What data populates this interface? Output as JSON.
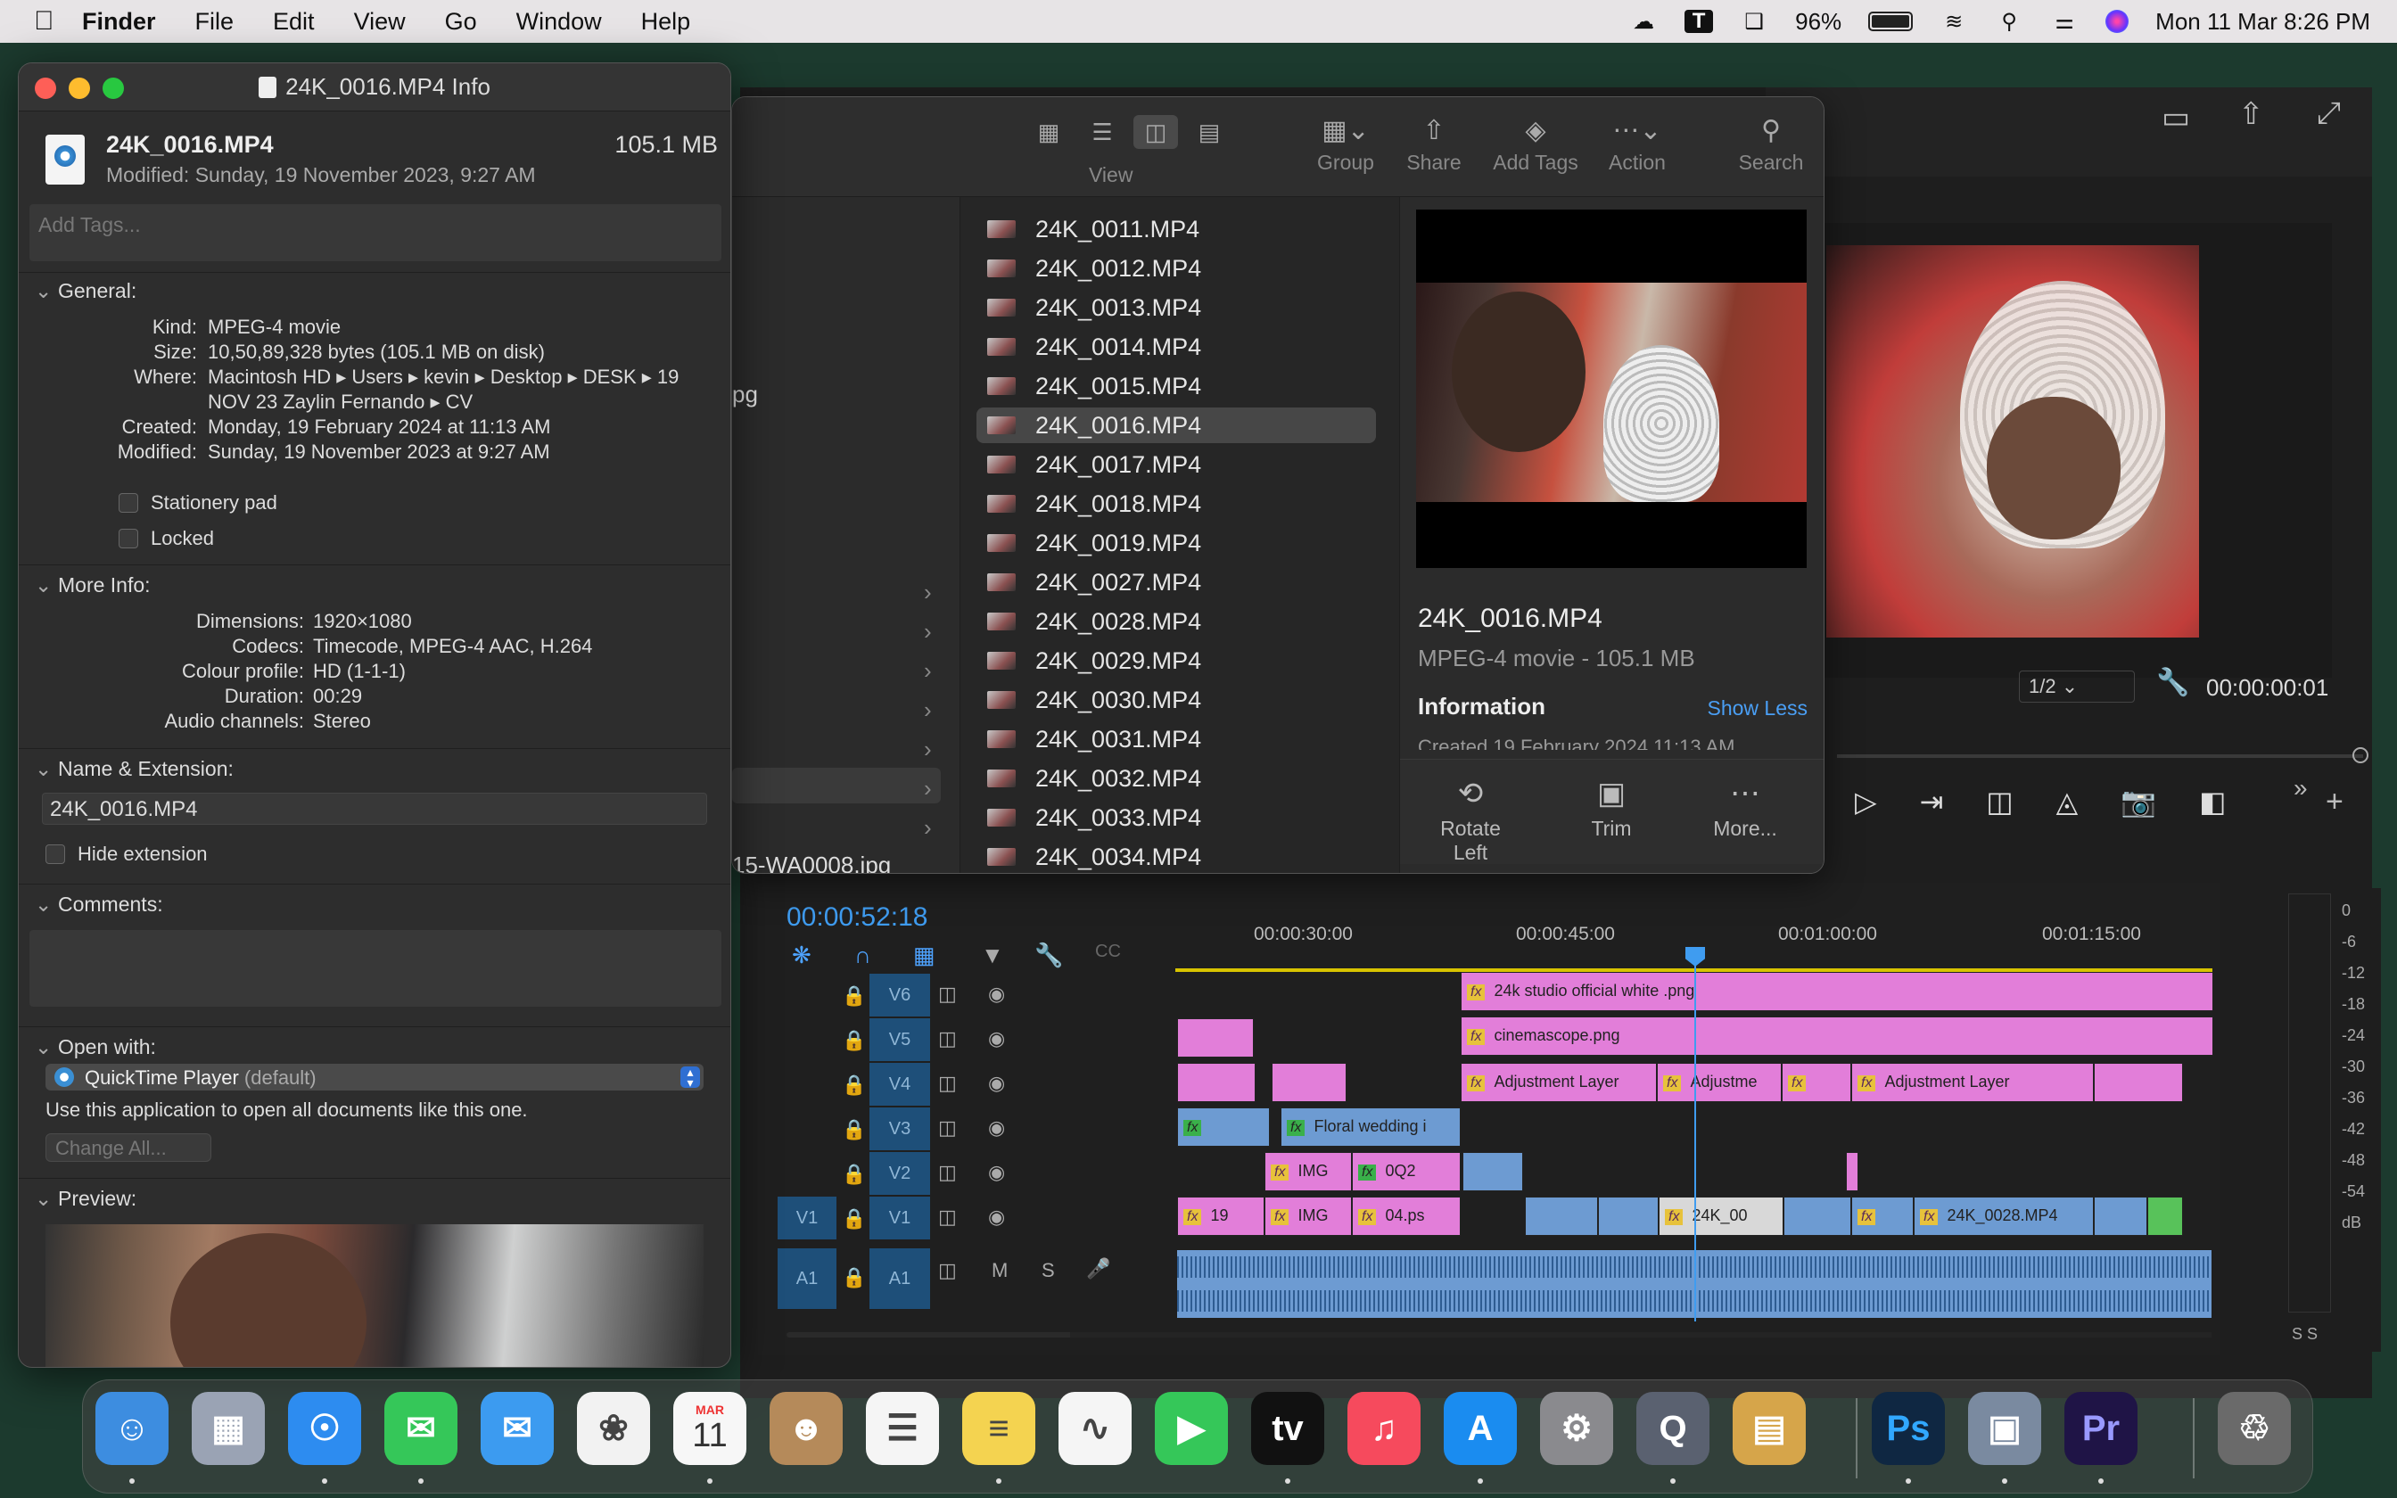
{
  "menubar": {
    "app_name": "Finder",
    "menus": [
      "File",
      "Edit",
      "View",
      "Go",
      "Window",
      "Help"
    ],
    "battery": "96%",
    "datetime": "Mon 11 Mar  8:26 PM",
    "icons": [
      "creative-cloud-icon",
      "typinator-icon",
      "screen-mirror-icon",
      "battery-icon",
      "wifi-icon",
      "spotlight-icon",
      "control-center-icon",
      "siri-icon"
    ]
  },
  "info_window": {
    "title": "24K_0016.MP4 Info",
    "file_name": "24K_0016.MP4",
    "file_size": "105.1 MB",
    "modified_line": "Modified: Sunday, 19 November 2023, 9:27 AM",
    "tags_placeholder": "Add Tags...",
    "general": {
      "label": "General:",
      "kind_k": "Kind:",
      "kind_v": "MPEG-4 movie",
      "size_k": "Size:",
      "size_v": "10,50,89,328 bytes (105.1 MB on disk)",
      "where_k": "Where:",
      "where_v": "Macintosh HD ▸ Users ▸ kevin ▸ Desktop ▸ DESK  ▸ 19 NOV 23 Zaylin Fernando ▸ CV",
      "created_k": "Created:",
      "created_v": "Monday, 19 February 2024 at 11:13 AM",
      "modified_k": "Modified:",
      "modified_v": "Sunday, 19 November 2023 at 9:27 AM",
      "stationery": "Stationery pad",
      "locked": "Locked"
    },
    "more_info": {
      "label": "More Info:",
      "dimensions_k": "Dimensions:",
      "dimensions_v": "1920×1080",
      "codecs_k": "Codecs:",
      "codecs_v": "Timecode, MPEG-4 AAC, H.264",
      "colour_k": "Colour profile:",
      "colour_v": "HD (1-1-1)",
      "duration_k": "Duration:",
      "duration_v": "00:29",
      "audio_k": "Audio channels:",
      "audio_v": "Stereo"
    },
    "name_ext": {
      "label": "Name & Extension:",
      "value": "24K_0016.MP4",
      "hide_ext": "Hide extension"
    },
    "comments_label": "Comments:",
    "open_with": {
      "label": "Open with:",
      "app": "QuickTime Player",
      "app_suffix": "(default)",
      "hint": "Use this application to open all documents like this one.",
      "change_all": "Change All..."
    },
    "preview_label": "Preview:"
  },
  "finder": {
    "toolbar": {
      "view": "View",
      "group": "Group",
      "share": "Share",
      "add_tags": "Add Tags",
      "action": "Action",
      "search": "Search"
    },
    "behind_text_1": "pg",
    "behind_text_2": "15-WA0008.jpg",
    "files": [
      "24K_0011.MP4",
      "24K_0012.MP4",
      "24K_0013.MP4",
      "24K_0014.MP4",
      "24K_0015.MP4",
      "24K_0016.MP4",
      "24K_0017.MP4",
      "24K_0018.MP4",
      "24K_0019.MP4",
      "24K_0027.MP4",
      "24K_0028.MP4",
      "24K_0029.MP4",
      "24K_0030.MP4",
      "24K_0031.MP4",
      "24K_0032.MP4",
      "24K_0033.MP4",
      "24K_0034.MP4"
    ],
    "selected_file": "24K_0016.MP4",
    "preview": {
      "name": "24K_0016.MP4",
      "subtitle": "MPEG-4 movie - 105.1 MB",
      "info_label": "Information",
      "show_less": "Show Less",
      "created_partial": "Created          19 February 2024  11:13 AM",
      "rotate_left": "Rotate Left",
      "trim": "Trim",
      "more": "More..."
    }
  },
  "premiere": {
    "program_timecode": "00:00:00:01",
    "zoom_select": "1/2",
    "timeline_timecode": "00:00:52:18",
    "ruler_labels": [
      "00:00:30:00",
      "00:00:45:00",
      "00:01:00:00",
      "00:01:15:00"
    ],
    "tracks": [
      "V6",
      "V5",
      "V4",
      "V3",
      "V2",
      "V1",
      "A1"
    ],
    "source_v1": "V1",
    "source_a1": "A1",
    "audio_m": "M",
    "audio_s": "S",
    "clips": {
      "studio_white": "24k studio official white .png",
      "cinemascope": "cinemascope.png",
      "adjustment_1": "Adjustment Layer",
      "adjustment_2": "Adjustme",
      "adjustment_3": "Adjustment Layer",
      "floral": "Floral wedding i",
      "img_1": "IMG",
      "oq2": "0Q2",
      "c19": "19",
      "img_2": "IMG",
      "ps04": "04.ps",
      "k24_00": "24K_00",
      "k24_0028": "24K_0028.MP4",
      "fx": "fx",
      "c": "C"
    },
    "meter_scale": [
      "0",
      "-6",
      "-12",
      "-18",
      "-24",
      "-30",
      "-36",
      "-42",
      "-48",
      "-54",
      "dB"
    ],
    "meter_solo": "S  S"
  },
  "dock": {
    "apps": [
      {
        "name": "finder",
        "color": "#3d8de0",
        "glyph": "☺"
      },
      {
        "name": "launchpad",
        "color": "#9aa3b4",
        "glyph": "▦"
      },
      {
        "name": "safari",
        "color": "#2d8cf0",
        "glyph": "☉"
      },
      {
        "name": "messages",
        "color": "#35c759",
        "glyph": "✉"
      },
      {
        "name": "mail",
        "color": "#3c9bf0",
        "glyph": "✉"
      },
      {
        "name": "photos",
        "color": "#f2f2f2",
        "glyph": "❀"
      },
      {
        "name": "calendar",
        "color": "#f7f7f7",
        "glyph": "11"
      },
      {
        "name": "contacts",
        "color": "#b58a5a",
        "glyph": "☻"
      },
      {
        "name": "reminders",
        "color": "#f5f5f5",
        "glyph": "☰"
      },
      {
        "name": "notes",
        "color": "#f4d350",
        "glyph": "≡"
      },
      {
        "name": "freeform",
        "color": "#f5f5f5",
        "glyph": "∿"
      },
      {
        "name": "facetime",
        "color": "#35c759",
        "glyph": "▶"
      },
      {
        "name": "apple-tv",
        "color": "#111111",
        "glyph": "tv"
      },
      {
        "name": "music",
        "color": "#f64a5d",
        "glyph": "♫"
      },
      {
        "name": "app-store",
        "color": "#1a8cf0",
        "glyph": "A"
      },
      {
        "name": "system-settings",
        "color": "#8a8a8e",
        "glyph": "⚙"
      },
      {
        "name": "quicktime",
        "color": "#5a6170",
        "glyph": "Q"
      },
      {
        "name": "archive-utility",
        "color": "#d6a54a",
        "glyph": "▤"
      },
      {
        "name": "photoshop",
        "color": "#0f2742",
        "glyph": "Ps"
      },
      {
        "name": "preview",
        "color": "#7a8aa0",
        "glyph": "▣"
      },
      {
        "name": "premiere-pro",
        "color": "#1f1446",
        "glyph": "Pr"
      },
      {
        "name": "trash",
        "color": "#6a6a6a",
        "glyph": "♲"
      }
    ],
    "calendar_month": "MAR",
    "calendar_day": "11"
  },
  "colors": {
    "accent_blue": "#3f9cf0",
    "clip_pink": "#e27ed9",
    "clip_blue": "#6d9bd2",
    "track_blue": "#1e4f79"
  }
}
